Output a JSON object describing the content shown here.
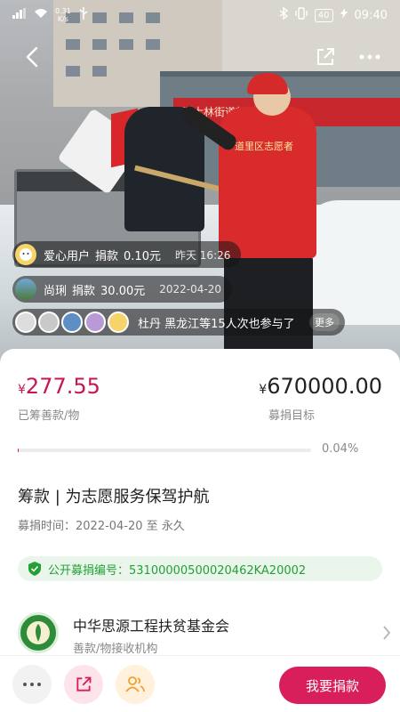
{
  "status_bar": {
    "net_speed": "0.31",
    "net_unit": "K/s",
    "battery": "40",
    "time": "09:40"
  },
  "hero": {
    "banner_text": "斯大林街道新时代文明",
    "vest_text": "道里区志愿者"
  },
  "tickers": [
    {
      "user": "爱心用户",
      "action": "捐款",
      "amount": "0.10元",
      "time": "昨天 16:26"
    },
    {
      "user": "尚琍",
      "action": "捐款",
      "amount": "30.00元",
      "time": "2022-04-20"
    }
  ],
  "participants": {
    "text": "杜丹 黑龙江等15人次也参与了",
    "more_label": "更多"
  },
  "fundraise": {
    "currency": "¥",
    "raised": "277.55",
    "raised_label": "已筹善款/物",
    "goal": "670000.00",
    "goal_label": "募捐目标",
    "progress_percent_text": "0.04%",
    "progress_fraction": 0.0004
  },
  "project": {
    "title": "筹款 | 为志愿服务保驾护航",
    "time_text": "募捐时间：2022-04-20 至 永久"
  },
  "public_code": {
    "text": "公开募捐编号：53100000500020462KA20002"
  },
  "organization": {
    "name": "中华思源工程扶贫基金会",
    "subtitle": "善款/物接收机构"
  },
  "bottom_bar": {
    "donate_label": "我要捐款"
  },
  "colors": {
    "accent": "#d81e5b",
    "raised_text": "#c8174e",
    "code_green": "#23a035"
  }
}
